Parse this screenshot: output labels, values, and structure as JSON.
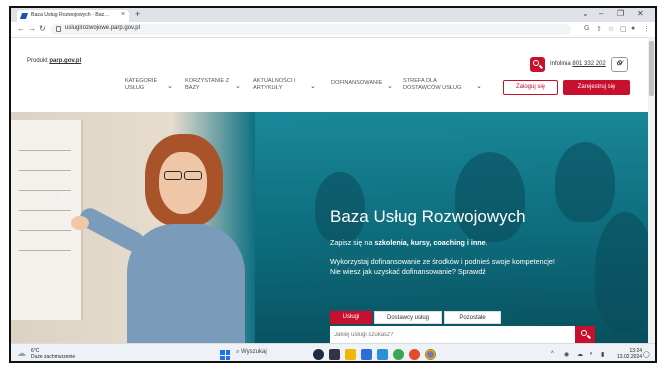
{
  "browser": {
    "tab_title": "Baza Usług Rozwojowych - Baz…",
    "tab_close": "×",
    "new_tab": "+",
    "url": "uslugirozwojowe.parp.gov.pl",
    "window_controls": [
      "⌄",
      "–",
      "❐",
      "✕"
    ]
  },
  "header": {
    "brand_prefix": "Produkt",
    "brand_link": "parp.gov.pl",
    "nav": [
      {
        "label": "KATEGORIE USŁUG"
      },
      {
        "label": "KORZYSTANIE Z BAZY"
      },
      {
        "label": "AKTUALNOŚCI I ARTYKUŁY"
      },
      {
        "label": "DOFINANSOWANIE"
      },
      {
        "label": "STREFA DLA DOSTAWCÓW USŁUG"
      }
    ],
    "infolinia_label": "Infolinia",
    "infolinia_number": "801 332 202",
    "a11y_label": "Ꮻ⁄",
    "login_label": "Zaloguj się",
    "register_label": "Zarejestruj się"
  },
  "hero": {
    "title": "Baza Usług Rozwojowych",
    "sub_prefix": "Zapisz się na ",
    "sub_bold": "szkolenia, kursy, coaching i inne",
    "sub_suffix": ".",
    "line1": "Wykorzystaj dofinansowanie ze środków i podnieś swoje kompetencje!",
    "line2": "Nie wiesz jak uzyskać dofinansowanie? Sprawdź",
    "search_tabs": [
      "Usługi",
      "Dostawcy usług",
      "Pozostałe"
    ],
    "search_placeholder": "Jakiej usługi szukasz?"
  },
  "taskbar": {
    "temp": "6°C",
    "weather": "Duże zachmurzenie",
    "search_label": "Wyszukaj",
    "time": "13:24",
    "date": "13.02.2024"
  },
  "colors": {
    "brand_red": "#c8102e",
    "hero_teal": "#0e6c7c"
  }
}
